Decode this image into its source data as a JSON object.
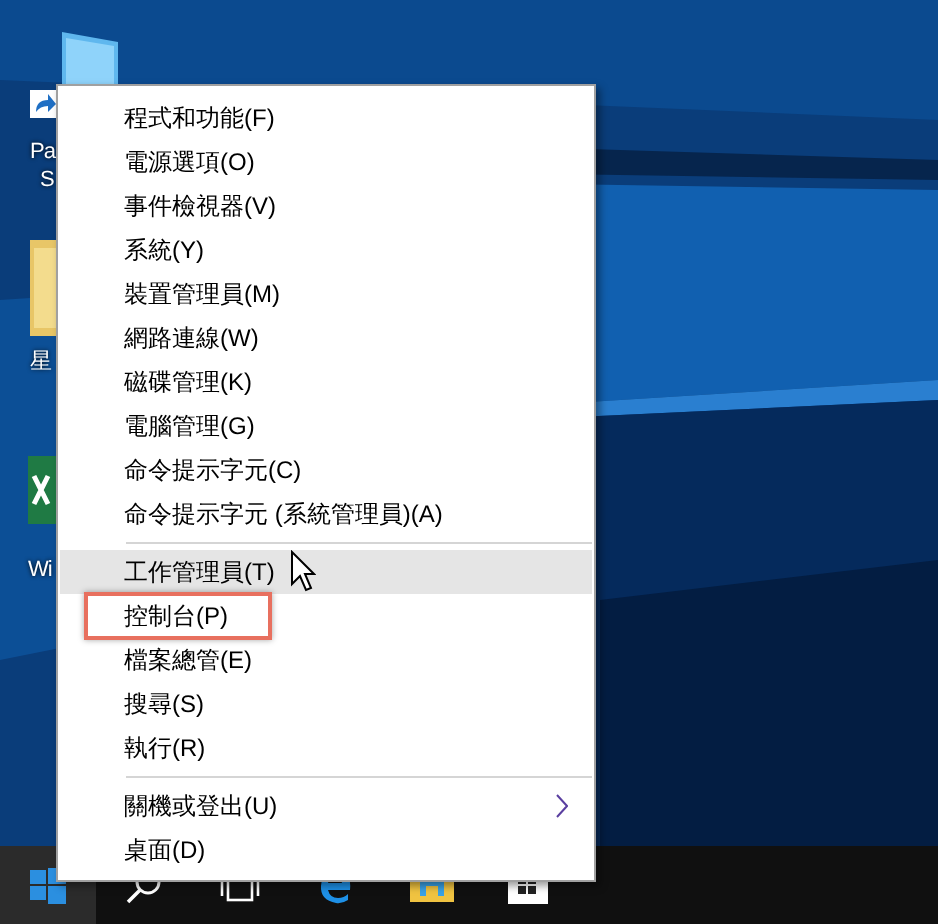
{
  "desktop_icons": [
    {
      "kind": "monitor"
    },
    {
      "kind": "shortcut",
      "labels": [
        "Pa",
        "S"
      ]
    },
    {
      "kind": "folder",
      "labels": [
        "星"
      ]
    },
    {
      "kind": "spreadsheet",
      "labels": [
        "Wi"
      ]
    }
  ],
  "menu": {
    "groups": [
      {
        "items": [
          {
            "label": "程式和功能(F)",
            "hovered": false,
            "annotated": false,
            "submenu": false
          },
          {
            "label": "電源選項(O)",
            "hovered": false,
            "annotated": false,
            "submenu": false
          },
          {
            "label": "事件檢視器(V)",
            "hovered": false,
            "annotated": false,
            "submenu": false
          },
          {
            "label": "系統(Y)",
            "hovered": false,
            "annotated": false,
            "submenu": false
          },
          {
            "label": "裝置管理員(M)",
            "hovered": false,
            "annotated": false,
            "submenu": false
          },
          {
            "label": "網路連線(W)",
            "hovered": false,
            "annotated": false,
            "submenu": false
          },
          {
            "label": "磁碟管理(K)",
            "hovered": false,
            "annotated": false,
            "submenu": false
          },
          {
            "label": "電腦管理(G)",
            "hovered": false,
            "annotated": false,
            "submenu": false
          },
          {
            "label": "命令提示字元(C)",
            "hovered": false,
            "annotated": false,
            "submenu": false
          },
          {
            "label": "命令提示字元 (系統管理員)(A)",
            "hovered": false,
            "annotated": false,
            "submenu": false
          }
        ]
      },
      {
        "items": [
          {
            "label": "工作管理員(T)",
            "hovered": true,
            "annotated": false,
            "submenu": false
          },
          {
            "label": "控制台(P)",
            "hovered": false,
            "annotated": true,
            "submenu": false
          },
          {
            "label": "檔案總管(E)",
            "hovered": false,
            "annotated": false,
            "submenu": false
          },
          {
            "label": "搜尋(S)",
            "hovered": false,
            "annotated": false,
            "submenu": false
          },
          {
            "label": "執行(R)",
            "hovered": false,
            "annotated": false,
            "submenu": false
          }
        ]
      },
      {
        "items": [
          {
            "label": "關機或登出(U)",
            "hovered": false,
            "annotated": false,
            "submenu": true
          },
          {
            "label": "桌面(D)",
            "hovered": false,
            "annotated": false,
            "submenu": false
          }
        ]
      }
    ]
  },
  "taskbar": {
    "start_button": {
      "selected": true
    },
    "apps": [
      {
        "kind": "search"
      },
      {
        "kind": "task-view"
      },
      {
        "kind": "browser"
      },
      {
        "kind": "file-explorer"
      },
      {
        "kind": "store"
      }
    ]
  }
}
